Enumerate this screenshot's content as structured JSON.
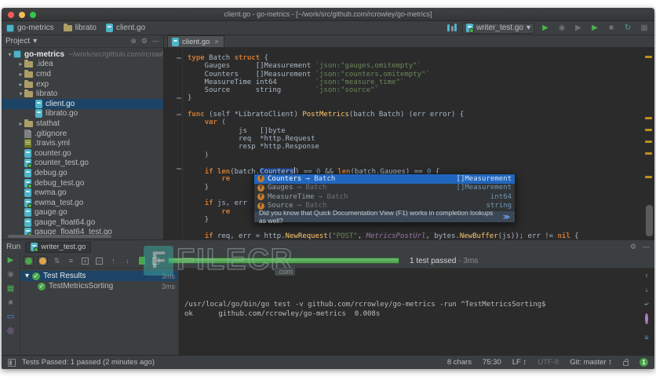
{
  "icons": {
    "chevron_down": "▾",
    "chevron_right": "▸",
    "close": "×",
    "play": "▶",
    "stop": "■",
    "refresh": "↻",
    "bug": "◉",
    "window": "▦",
    "monitor": "▭",
    "pin": "◎",
    "coverage": "▦",
    "up": "↑",
    "down": "↓",
    "sort": "⇅",
    "menu": "≡",
    "minimize": "—",
    "gear": "⚙",
    "locate": "⊕",
    "wrap": "↩",
    "scroll_end": "⇊"
  },
  "title_bar": {
    "title": "client.go - go-metrics - [~/work/src/github.com/rcrowley/go-metrics]"
  },
  "nav": {
    "breadcrumbs": [
      {
        "label": "go-metrics",
        "icon": "project"
      },
      {
        "label": "librato",
        "icon": "folder"
      },
      {
        "label": "client.go",
        "icon": "go"
      }
    ],
    "run_config": "writer_test.go"
  },
  "project_panel": {
    "title": "Project",
    "tree": [
      {
        "label": "go-metrics",
        "suffix": "~/work/src/github.com/rcrowley",
        "icon": "project",
        "indent": 0,
        "chevron": "down",
        "root": true
      },
      {
        "label": ".idea",
        "icon": "folder",
        "indent": 1,
        "chevron": "right"
      },
      {
        "label": "cmd",
        "icon": "folder",
        "indent": 1,
        "chevron": "right"
      },
      {
        "label": "exp",
        "icon": "folder",
        "indent": 1,
        "chevron": "right"
      },
      {
        "label": "librato",
        "icon": "folder",
        "indent": 1,
        "chevron": "down"
      },
      {
        "label": "client.go",
        "icon": "go",
        "indent": 2,
        "selected": true
      },
      {
        "label": "librato.go",
        "icon": "go",
        "indent": 2
      },
      {
        "label": "stathat",
        "icon": "folder",
        "indent": 1,
        "chevron": "right"
      },
      {
        "label": ".gitignore",
        "icon": "file",
        "indent": 1
      },
      {
        "label": ".travis.yml",
        "icon": "yml",
        "indent": 1
      },
      {
        "label": "counter.go",
        "icon": "go",
        "indent": 1
      },
      {
        "label": "counter_test.go",
        "icon": "gotest",
        "indent": 1
      },
      {
        "label": "debug.go",
        "icon": "go",
        "indent": 1
      },
      {
        "label": "debug_test.go",
        "icon": "gotest",
        "indent": 1
      },
      {
        "label": "ewma.go",
        "icon": "go",
        "indent": 1
      },
      {
        "label": "ewma_test.go",
        "icon": "gotest",
        "indent": 1
      },
      {
        "label": "gauge.go",
        "icon": "go",
        "indent": 1
      },
      {
        "label": "gauge_float64.go",
        "icon": "go",
        "indent": 1
      },
      {
        "label": "gauge_float64_test.go",
        "icon": "gotest",
        "indent": 1
      }
    ]
  },
  "editor": {
    "tab": "client.go",
    "code_lines": [
      [
        [
          "k",
          "type"
        ],
        [
          "p",
          " Batch "
        ],
        [
          "k",
          "struct"
        ],
        [
          "p",
          " {"
        ]
      ],
      [
        [
          "p",
          "    Gauges      []Measurement "
        ],
        [
          "s",
          "`json:\"gauges,omitempty\"`"
        ]
      ],
      [
        [
          "p",
          "    Counters    []Measurement "
        ],
        [
          "s",
          "`json:\"counters,omitempty\"`"
        ]
      ],
      [
        [
          "p",
          "    MeasureTime int64         "
        ],
        [
          "s",
          "`json:\"measure_time\"`"
        ]
      ],
      [
        [
          "p",
          "    Source      string        "
        ],
        [
          "s",
          "`json:\"source\"`"
        ]
      ],
      [
        [
          "p",
          "}"
        ]
      ],
      [],
      [
        [
          "k",
          "func"
        ],
        [
          "p",
          " (self *LibratoClient) "
        ],
        [
          "f",
          "PostMetrics"
        ],
        [
          "p",
          "(batch Batch) (err error) {"
        ]
      ],
      [
        [
          "p",
          "    "
        ],
        [
          "k",
          "var"
        ],
        [
          "p",
          " ("
        ]
      ],
      [
        [
          "p",
          "            js   []byte"
        ]
      ],
      [
        [
          "p",
          "            req  *http.Request"
        ]
      ],
      [
        [
          "p",
          "            resp *http.Response"
        ]
      ],
      [
        [
          "p",
          "    )"
        ]
      ],
      [],
      [
        [
          "p",
          "    "
        ],
        [
          "k",
          "if"
        ],
        [
          "p",
          " "
        ],
        [
          "k",
          "len"
        ],
        [
          "p",
          "(batch."
        ],
        [
          "sel",
          "Counters"
        ],
        [
          "caret",
          ""
        ],
        [
          "p",
          ") == "
        ],
        [
          "n",
          "0"
        ],
        [
          "p",
          " && "
        ],
        [
          "k",
          "len"
        ],
        [
          "p",
          "(batch.Gauges) == "
        ],
        [
          "n",
          "0"
        ],
        [
          "p",
          " {"
        ]
      ],
      [
        [
          "p",
          "        "
        ],
        [
          "k",
          "re"
        ]
      ],
      [
        [
          "p",
          "    }"
        ]
      ],
      [],
      [
        [
          "p",
          "    "
        ],
        [
          "k",
          "if"
        ],
        [
          "p",
          " js, err"
        ]
      ],
      [
        [
          "p",
          "        "
        ],
        [
          "k",
          "re"
        ]
      ],
      [
        [
          "p",
          "    }"
        ]
      ],
      [],
      [
        [
          "p",
          "    "
        ],
        [
          "k",
          "if"
        ],
        [
          "p",
          " req, err = http."
        ],
        [
          "f",
          "NewRequest"
        ],
        [
          "p",
          "("
        ],
        [
          "s",
          "\"POST\""
        ],
        [
          "p",
          ", "
        ],
        [
          "c",
          "MetricsPostUrl"
        ],
        [
          "p",
          ", bytes."
        ],
        [
          "f",
          "NewBuffer"
        ],
        [
          "p",
          "(js)); err != "
        ],
        [
          "k",
          "nil"
        ],
        [
          "p",
          " {"
        ]
      ]
    ]
  },
  "completion": {
    "arrow": "→",
    "items": [
      {
        "name": "Counters",
        "origin": "Batch",
        "type": "[]Measurement",
        "selected": true
      },
      {
        "name": "Gauges",
        "origin": "Batch",
        "type": "[]Measurement"
      },
      {
        "name": "MeasureTime",
        "origin": "Batch",
        "type": "int64"
      },
      {
        "name": "Source",
        "origin": "Batch",
        "type": "string"
      }
    ],
    "tip": "Did you know that Quick Documentation View (F1) works in completion lookups as well?",
    "tip_link": "≫"
  },
  "run_panel": {
    "label": "Run",
    "tab": "writer_test.go",
    "progress_text": "1 test passed",
    "progress_sep": "-",
    "progress_time": "3ms",
    "tests": [
      {
        "label": "Test Results",
        "time": "3ms",
        "selected": true,
        "level": 0,
        "chevron": true
      },
      {
        "label": "TestMetricsSorting",
        "time": "3ms",
        "level": 1
      }
    ],
    "console": [
      "/usr/local/go/bin/go test -v github.com/rcrowley/go-metrics -run ^TestMetricsSorting$",
      "ok      github.com/rcrowley/go-metrics  0.008s"
    ]
  },
  "status_bar": {
    "message": "Tests Passed: 1 passed (2 minutes ago)",
    "right": [
      {
        "text": "8 chars"
      },
      {
        "text": "75:30"
      },
      {
        "text": "LF ↕"
      },
      {
        "text": "UTF-8",
        "dim": true
      },
      {
        "text": "Git: master ↕"
      }
    ],
    "badge": "1"
  },
  "watermark": {
    "text": "FILECR",
    "sub": ".com"
  },
  "colors": {
    "panel_bg": "#3C3F41",
    "editor_bg": "#2B2B2B",
    "selection_blue": "#1D4466",
    "completion_selected": "#2166BE",
    "progress_green": "#4E9C4E",
    "keyword_orange": "#CC7832",
    "string_green": "#6A8759",
    "function_yellow": "#FFC66D"
  }
}
